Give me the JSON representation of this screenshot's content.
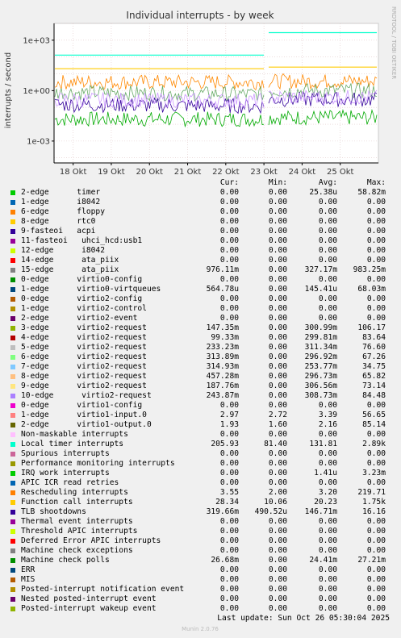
{
  "chart_data": {
    "type": "line",
    "title": "Individual interrupts - by week",
    "ylabel": "interrupts / second",
    "xlabel": "",
    "y_scale": "log",
    "ylim": [
      5e-05,
      10000
    ],
    "y_ticks": [
      "1e+03",
      "1e+00",
      "1e-03"
    ],
    "y_tick_values": [
      1000,
      1,
      0.001
    ],
    "x_tick_labels": [
      "18 Okt",
      "19 Okt",
      "20 Okt",
      "21 Okt",
      "22 Okt",
      "23 Okt",
      "24 Okt",
      "25 Okt"
    ],
    "side_label": "RRDTOOL / TOBI OETIKER",
    "grid": true,
    "series": [
      {
        "name": "Local timer interrupts",
        "color": "#00ffcc",
        "levels": [
          130,
          130,
          2800
        ]
      },
      {
        "name": "Function call interrupts",
        "color": "#ffcc00",
        "levels": [
          20,
          20,
          25
        ]
      },
      {
        "name": "Machine check polls",
        "color": "#00aa00",
        "levels": [
          0.02,
          0.02,
          0.025
        ]
      },
      {
        "name": "Rescheduling interrupts",
        "color": "#ff8800",
        "levels": [
          3.2,
          3.2,
          3.6
        ]
      },
      {
        "name": "15-edge ata_piix",
        "color": "#66aa66",
        "levels": [
          0.8,
          0.6,
          1.0
        ]
      },
      {
        "name": "TLB shootdowns",
        "color": "#330099",
        "levels": [
          0.15,
          0.12,
          0.3
        ]
      },
      {
        "name": "virtio2-request",
        "color": "#cc99ff",
        "levels": [
          0.3,
          0.25,
          0.4
        ]
      }
    ],
    "legend_header": {
      "cur": "Cur:",
      "min": "Min:",
      "avg": "Avg:",
      "max": "Max:"
    },
    "legend": [
      {
        "label": "2-edge      timer",
        "color": "#00cc00",
        "cur": "0.00",
        "min": "0.00",
        "avg": "25.38u",
        "max": "58.82m"
      },
      {
        "label": "1-edge      i8042",
        "color": "#0066b3",
        "cur": "0.00",
        "min": "0.00",
        "avg": "0.00",
        "max": "0.00"
      },
      {
        "label": "6-edge      floppy",
        "color": "#ff8000",
        "cur": "0.00",
        "min": "0.00",
        "avg": "0.00",
        "max": "0.00"
      },
      {
        "label": "8-edge      rtc0",
        "color": "#ffcc00",
        "cur": "0.00",
        "min": "0.00",
        "avg": "0.00",
        "max": "0.00"
      },
      {
        "label": "9-fasteoi   acpi",
        "color": "#330099",
        "cur": "0.00",
        "min": "0.00",
        "avg": "0.00",
        "max": "0.00"
      },
      {
        "label": "11-fasteoi   uhci_hcd:usb1",
        "color": "#990099",
        "cur": "0.00",
        "min": "0.00",
        "avg": "0.00",
        "max": "0.00"
      },
      {
        "label": "12-edge      i8042",
        "color": "#ccff00",
        "cur": "0.00",
        "min": "0.00",
        "avg": "0.00",
        "max": "0.00"
      },
      {
        "label": "14-edge      ata_piix",
        "color": "#ff0000",
        "cur": "0.00",
        "min": "0.00",
        "avg": "0.00",
        "max": "0.00"
      },
      {
        "label": "15-edge      ata_piix",
        "color": "#808080",
        "cur": "976.11m",
        "min": "0.00",
        "avg": "327.17m",
        "max": "983.25m"
      },
      {
        "label": "0-edge      virtio0-config",
        "color": "#008f00",
        "cur": "0.00",
        "min": "0.00",
        "avg": "0.00",
        "max": "0.00"
      },
      {
        "label": "1-edge      virtio0-virtqueues",
        "color": "#00487d",
        "cur": "564.78u",
        "min": "0.00",
        "avg": "145.41u",
        "max": "68.03m"
      },
      {
        "label": "0-edge      virtio2-config",
        "color": "#b35a00",
        "cur": "0.00",
        "min": "0.00",
        "avg": "0.00",
        "max": "0.00"
      },
      {
        "label": "1-edge      virtio2-control",
        "color": "#b38f00",
        "cur": "0.00",
        "min": "0.00",
        "avg": "0.00",
        "max": "0.00"
      },
      {
        "label": "2-edge      virtio2-event",
        "color": "#6b006b",
        "cur": "0.00",
        "min": "0.00",
        "avg": "0.00",
        "max": "0.00"
      },
      {
        "label": "3-edge      virtio2-request",
        "color": "#8fb300",
        "cur": "147.35m",
        "min": "0.00",
        "avg": "300.99m",
        "max": "106.17"
      },
      {
        "label": "4-edge      virtio2-request",
        "color": "#b30000",
        "cur": "99.33m",
        "min": "0.00",
        "avg": "299.81m",
        "max": "83.64"
      },
      {
        "label": "5-edge      virtio2-request",
        "color": "#bebebe",
        "cur": "233.23m",
        "min": "0.00",
        "avg": "311.34m",
        "max": "76.60"
      },
      {
        "label": "6-edge      virtio2-request",
        "color": "#80ff80",
        "cur": "313.89m",
        "min": "0.00",
        "avg": "296.92m",
        "max": "67.26"
      },
      {
        "label": "7-edge      virtio2-request",
        "color": "#80c9ff",
        "cur": "314.93m",
        "min": "0.00",
        "avg": "253.77m",
        "max": "34.75"
      },
      {
        "label": "8-edge      virtio2-request",
        "color": "#ffc080",
        "cur": "457.28m",
        "min": "0.00",
        "avg": "296.73m",
        "max": "65.82"
      },
      {
        "label": "9-edge      virtio2-request",
        "color": "#ffe680",
        "cur": "187.76m",
        "min": "0.00",
        "avg": "306.56m",
        "max": "73.14"
      },
      {
        "label": "10-edge      virtio2-request",
        "color": "#aa80ff",
        "cur": "243.87m",
        "min": "0.00",
        "avg": "308.73m",
        "max": "84.48"
      },
      {
        "label": "0-edge      virtio1-config",
        "color": "#ee00cc",
        "cur": "0.00",
        "min": "0.00",
        "avg": "0.00",
        "max": "0.00"
      },
      {
        "label": "1-edge      virtio1-input.0",
        "color": "#ff8080",
        "cur": "2.97",
        "min": "2.72",
        "avg": "3.39",
        "max": "56.65"
      },
      {
        "label": "2-edge      virtio1-output.0",
        "color": "#666600",
        "cur": "1.93",
        "min": "1.60",
        "avg": "2.16",
        "max": "85.14"
      },
      {
        "label": "Non-maskable interrupts",
        "color": "#ffbfff",
        "cur": "0.00",
        "min": "0.00",
        "avg": "0.00",
        "max": "0.00"
      },
      {
        "label": "Local timer interrupts",
        "color": "#00ffcc",
        "cur": "205.93",
        "min": "81.40",
        "avg": "131.81",
        "max": "2.89k"
      },
      {
        "label": "Spurious interrupts",
        "color": "#cc6699",
        "cur": "0.00",
        "min": "0.00",
        "avg": "0.00",
        "max": "0.00"
      },
      {
        "label": "Performance monitoring interrupts",
        "color": "#999900",
        "cur": "0.00",
        "min": "0.00",
        "avg": "0.00",
        "max": "0.00"
      },
      {
        "label": "IRQ work interrupts",
        "color": "#00cc00",
        "cur": "0.00",
        "min": "0.00",
        "avg": "1.41u",
        "max": "3.23m"
      },
      {
        "label": "APIC ICR read retries",
        "color": "#0066b3",
        "cur": "0.00",
        "min": "0.00",
        "avg": "0.00",
        "max": "0.00"
      },
      {
        "label": "Rescheduling interrupts",
        "color": "#ff8000",
        "cur": "3.55",
        "min": "2.00",
        "avg": "3.20",
        "max": "219.71"
      },
      {
        "label": "Function call interrupts",
        "color": "#ffcc00",
        "cur": "28.34",
        "min": "10.06",
        "avg": "20.23",
        "max": "1.75k"
      },
      {
        "label": "TLB shootdowns",
        "color": "#330099",
        "cur": "319.66m",
        "min": "490.52u",
        "avg": "146.71m",
        "max": "16.16"
      },
      {
        "label": "Thermal event interrupts",
        "color": "#990099",
        "cur": "0.00",
        "min": "0.00",
        "avg": "0.00",
        "max": "0.00"
      },
      {
        "label": "Threshold APIC interrupts",
        "color": "#ccff00",
        "cur": "0.00",
        "min": "0.00",
        "avg": "0.00",
        "max": "0.00"
      },
      {
        "label": "Deferred Error APIC interrupts",
        "color": "#ff0000",
        "cur": "0.00",
        "min": "0.00",
        "avg": "0.00",
        "max": "0.00"
      },
      {
        "label": "Machine check exceptions",
        "color": "#808080",
        "cur": "0.00",
        "min": "0.00",
        "avg": "0.00",
        "max": "0.00"
      },
      {
        "label": "Machine check polls",
        "color": "#008f00",
        "cur": "26.68m",
        "min": "0.00",
        "avg": "24.41m",
        "max": "27.21m"
      },
      {
        "label": "ERR",
        "color": "#00487d",
        "cur": "0.00",
        "min": "0.00",
        "avg": "0.00",
        "max": "0.00"
      },
      {
        "label": "MIS",
        "color": "#b35a00",
        "cur": "0.00",
        "min": "0.00",
        "avg": "0.00",
        "max": "0.00"
      },
      {
        "label": "Posted-interrupt notification event",
        "color": "#b38f00",
        "cur": "0.00",
        "min": "0.00",
        "avg": "0.00",
        "max": "0.00"
      },
      {
        "label": "Nested posted-interrupt event",
        "color": "#6b006b",
        "cur": "0.00",
        "min": "0.00",
        "avg": "0.00",
        "max": "0.00"
      },
      {
        "label": "Posted-interrupt wakeup event",
        "color": "#8fb300",
        "cur": "0.00",
        "min": "0.00",
        "avg": "0.00",
        "max": "0.00"
      }
    ]
  },
  "last_update": "Last update: Sun Oct 26 05:30:04 2025",
  "footer": "Munin 2.0.76"
}
